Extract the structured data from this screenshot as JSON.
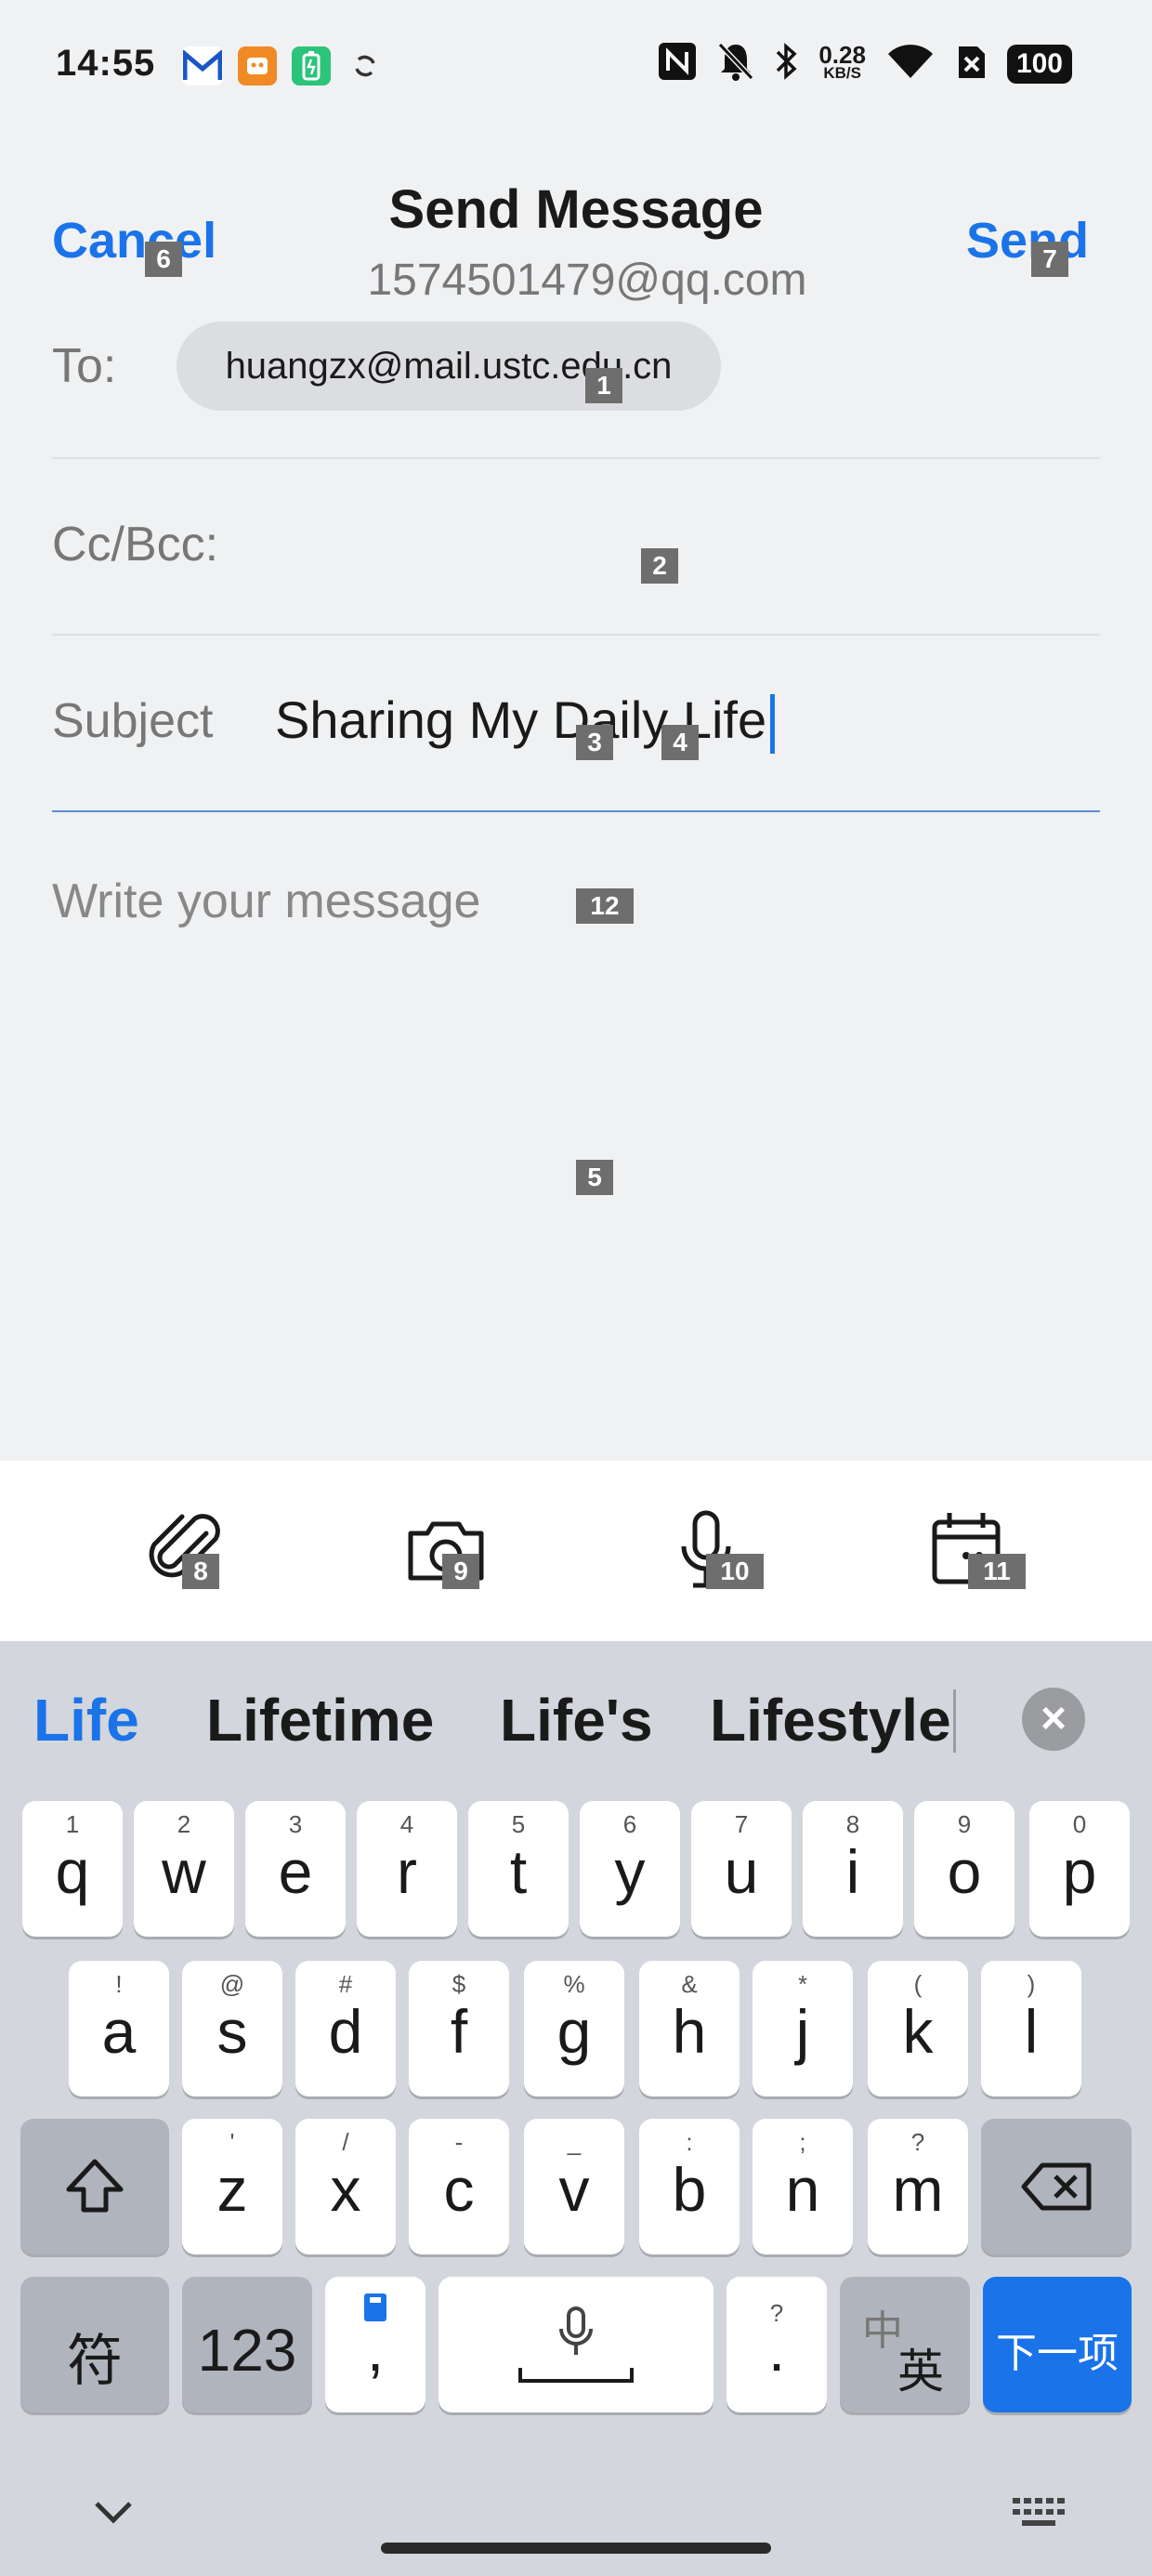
{
  "status_bar": {
    "time": "14:55",
    "net_speed_value": "0.28",
    "net_speed_unit": "KB/S",
    "battery": "100",
    "icons": [
      "gmail-icon",
      "app-icon",
      "battery-saver-icon",
      "sync-icon",
      "nfc-icon",
      "mute-icon",
      "bluetooth-icon",
      "wifi-icon",
      "sim-off-icon"
    ]
  },
  "header": {
    "cancel_label": "Cancel",
    "send_label": "Send",
    "title": "Send Message",
    "from_account": "1574501479@qq.com"
  },
  "form": {
    "to_label": "To:",
    "to_chip": "huangzx@mail.ustc.edu.cn",
    "ccbcc_label": "Cc/Bcc:",
    "subject_label": "Subject",
    "subject_value": "Sharing My Daily Life",
    "body_placeholder": "Write your message"
  },
  "toolbar": {
    "icons": [
      "attach-icon",
      "camera-icon",
      "microphone-icon",
      "calendar-icon"
    ]
  },
  "badges": {
    "b1": "1",
    "b2": "2",
    "b3": "3",
    "b4": "4",
    "b5": "5",
    "b6": "6",
    "b7": "7",
    "b8": "8",
    "b9": "9",
    "b10": "10",
    "b11": "11",
    "b12": "12"
  },
  "keyboard": {
    "suggestions": [
      "Life",
      "Lifetime",
      "Life's",
      "Lifestyle"
    ],
    "row1": [
      {
        "hint": "1",
        "ch": "q"
      },
      {
        "hint": "2",
        "ch": "w"
      },
      {
        "hint": "3",
        "ch": "e"
      },
      {
        "hint": "4",
        "ch": "r"
      },
      {
        "hint": "5",
        "ch": "t"
      },
      {
        "hint": "6",
        "ch": "y"
      },
      {
        "hint": "7",
        "ch": "u"
      },
      {
        "hint": "8",
        "ch": "i"
      },
      {
        "hint": "9",
        "ch": "o"
      },
      {
        "hint": "0",
        "ch": "p"
      }
    ],
    "row2": [
      {
        "hint": "!",
        "ch": "a"
      },
      {
        "hint": "@",
        "ch": "s"
      },
      {
        "hint": "#",
        "ch": "d"
      },
      {
        "hint": "$",
        "ch": "f"
      },
      {
        "hint": "%",
        "ch": "g"
      },
      {
        "hint": "&",
        "ch": "h"
      },
      {
        "hint": "*",
        "ch": "j"
      },
      {
        "hint": "(",
        "ch": "k"
      },
      {
        "hint": ")",
        "ch": "l"
      }
    ],
    "row3": [
      {
        "hint": "'",
        "ch": "z"
      },
      {
        "hint": "/",
        "ch": "x"
      },
      {
        "hint": "-",
        "ch": "c"
      },
      {
        "hint": "_",
        "ch": "v"
      },
      {
        "hint": ":",
        "ch": "b"
      },
      {
        "hint": ";",
        "ch": "n"
      },
      {
        "hint": "?",
        "ch": "m"
      }
    ],
    "symbols_label": "符",
    "numbers_label": "123",
    "comma_label": ",",
    "period_hint": "?",
    "period_label": ".",
    "lang_top": "中",
    "lang_bottom": "英",
    "next_label": "下一项"
  }
}
